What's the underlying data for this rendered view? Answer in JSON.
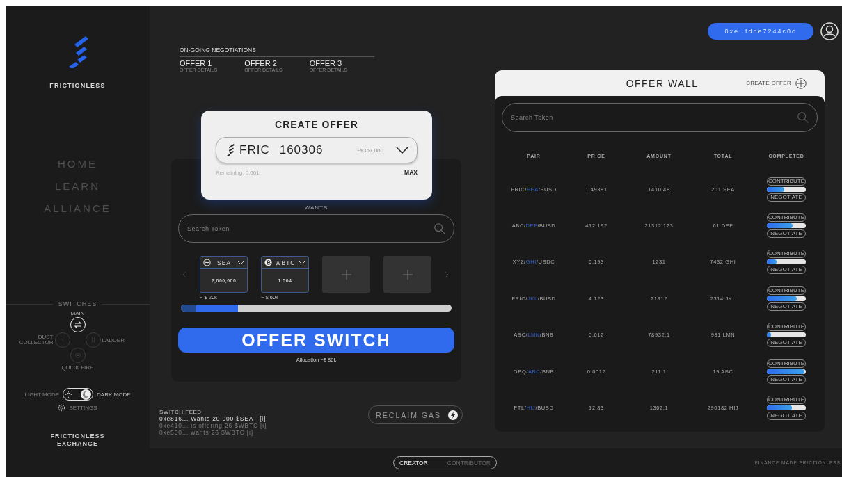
{
  "sidebar": {
    "brand": "FRICTIONLESS",
    "nav": [
      {
        "label": "HOME"
      },
      {
        "label": "LEARN"
      },
      {
        "label": "ALLIANCE"
      }
    ],
    "switches": {
      "title": "SWITCHES",
      "items": [
        {
          "label": "MAIN",
          "selected": true
        },
        {
          "label": "DUST COLLECTOR",
          "selected": false
        },
        {
          "label": "LADDER",
          "selected": false
        },
        {
          "label": "QUICK FIRE",
          "selected": false
        }
      ]
    },
    "theme": {
      "light_label": "LIGHT MODE",
      "dark_label": "DARK MODE",
      "dark": true
    },
    "settings": "SETTINGS",
    "footer": "FRICTIONLESS EXCHANGE"
  },
  "negotiations": {
    "title": "ON-GOING NEGOTIATIONS",
    "offers": [
      {
        "label": "OFFER 1",
        "detail": "OFFER DETAILS"
      },
      {
        "label": "OFFER 2",
        "detail": "OFFER DETAILS"
      },
      {
        "label": "OFFER 3",
        "detail": "OFFER DETAILS"
      }
    ]
  },
  "create_offer": {
    "title": "CREATE OFFER",
    "token": "FRIC",
    "amount": "160306",
    "value": "~$357,000",
    "remaining": "Remaining: 0.001",
    "max": "MAX"
  },
  "wants": {
    "title": "WANTS",
    "search_placeholder": "Search Token",
    "tokens": [
      {
        "kind": "token",
        "symbol": "SEA",
        "amount": "2,000,000",
        "value": "~ $ 20k"
      },
      {
        "kind": "token",
        "symbol": "WBTC",
        "amount": "1.504",
        "value": "~ $ 60k"
      },
      {
        "kind": "empty"
      },
      {
        "kind": "empty"
      }
    ],
    "allocation_bar": [
      {
        "level": 0.057
      },
      {
        "level": 0.155
      }
    ],
    "action": "OFFER SWITCH",
    "allocation": "Allocation ~$ 80k"
  },
  "feed": {
    "title": "SWITCH FEED",
    "items": [
      {
        "text": "0xe816... Wants 20,000 $SEA   [i]",
        "faded": false
      },
      {
        "text": "0xe410... is offering 26 $WBTC [i]",
        "faded": true
      },
      {
        "text": "0xe550... wants 26 $WBTC [i]",
        "faded": true
      }
    ]
  },
  "reclaim": "RECLAIM GAS",
  "account": {
    "address": "0xe..fdde7244c0c"
  },
  "offer_wall": {
    "title": "OFFER WALL",
    "create": "CREATE OFFER",
    "search_placeholder": "Search Token",
    "columns": [
      "PAIR",
      "PRICE",
      "AMOUNT",
      "TOTAL",
      "COMPLETED"
    ],
    "rows": [
      {
        "pair": [
          "FRIC/",
          "SEA",
          "/BUSD"
        ],
        "price": "1.49381",
        "amount": "1410.48",
        "total": "201 SEA",
        "level": 0.45,
        "contribute": "CONTRIBUTE",
        "negotiate": "NEGOTIATE"
      },
      {
        "pair": [
          "ABC/",
          "DEF",
          "/BUSD"
        ],
        "price": "412.192",
        "amount": "21312.123",
        "total": "61 DEF",
        "level": 0.66,
        "contribute": "CONTRIBUTE",
        "negotiate": "NEGOTIATE"
      },
      {
        "pair": [
          "XYZ/",
          "GHI",
          "/USDC"
        ],
        "price": "5.193",
        "amount": "1231",
        "total": "7432 GHI",
        "level": 0.25,
        "contribute": "CONTRIBUTE",
        "negotiate": "NEGOTIATE"
      },
      {
        "pair": [
          "FRIC/",
          "JKL",
          "/BUSD"
        ],
        "price": "4.123",
        "amount": "21312",
        "total": "2314 JKL",
        "level": 0.77,
        "contribute": "CONTRIBUTE",
        "negotiate": "NEGOTIATE"
      },
      {
        "pair": [
          "ABC/",
          "LMN",
          "/BNB"
        ],
        "price": "0.012",
        "amount": "78932.1",
        "total": "981 LMN",
        "level": 0.1,
        "contribute": "CONTRIBUTE",
        "negotiate": "NEGOTIATE"
      },
      {
        "pair": [
          "OPQ/",
          "ABC",
          "/BNB"
        ],
        "price": "0.0012",
        "amount": "211.1",
        "total": "19 ABC",
        "level": 0.97,
        "contribute": "CONTRIBUTE",
        "negotiate": "NEGOTIATE"
      },
      {
        "pair": [
          "FTL/",
          "HIJ",
          "/BUSD"
        ],
        "price": "12.83",
        "amount": "1302.1",
        "total": "290182 HIJ",
        "level": 0.65,
        "contribute": "CONTRIBUTE",
        "negotiate": "NEGOTIATE"
      }
    ]
  },
  "modes": [
    {
      "label": "CREATOR",
      "selected": true
    },
    {
      "label": "CONTRIBUTOR",
      "selected": false
    }
  ],
  "tagline": "FINANCE MADE FRICTIONLESS"
}
